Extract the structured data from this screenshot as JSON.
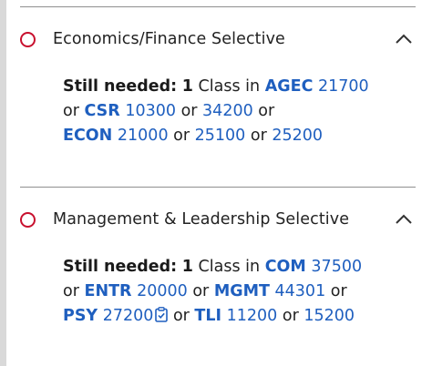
{
  "requirements": [
    {
      "title": "Economics/Finance Selective",
      "still_needed_label": "Still needed:",
      "count": "1",
      "unit": "Class",
      "in_word": "in",
      "or_word": "or",
      "courses": [
        {
          "subject": "AGEC",
          "number": "21700"
        },
        {
          "subject": "CSR",
          "number": "10300"
        },
        {
          "subject": "",
          "number": "34200"
        },
        {
          "subject": "ECON",
          "number": "21000"
        },
        {
          "subject": "",
          "number": "25100"
        },
        {
          "subject": "",
          "number": "25200"
        }
      ]
    },
    {
      "title": "Management & Leadership Selective",
      "still_needed_label": "Still needed:",
      "count": "1",
      "unit": "Class",
      "in_word": "in",
      "or_word": "or",
      "courses": [
        {
          "subject": "COM",
          "number": "37500"
        },
        {
          "subject": "ENTR",
          "number": "20000"
        },
        {
          "subject": "MGMT",
          "number": "44301"
        },
        {
          "subject": "PSY",
          "number": "27200"
        },
        {
          "subject": "TLI",
          "number": "11200"
        },
        {
          "subject": "",
          "number": "15200"
        }
      ]
    }
  ],
  "icons": {
    "status": "circle-outline-icon",
    "collapse": "chevron-up-icon",
    "clipboard": "clipboard-check-icon"
  },
  "colors": {
    "status_red": "#c8102e",
    "link_blue": "#1f5fbf"
  }
}
